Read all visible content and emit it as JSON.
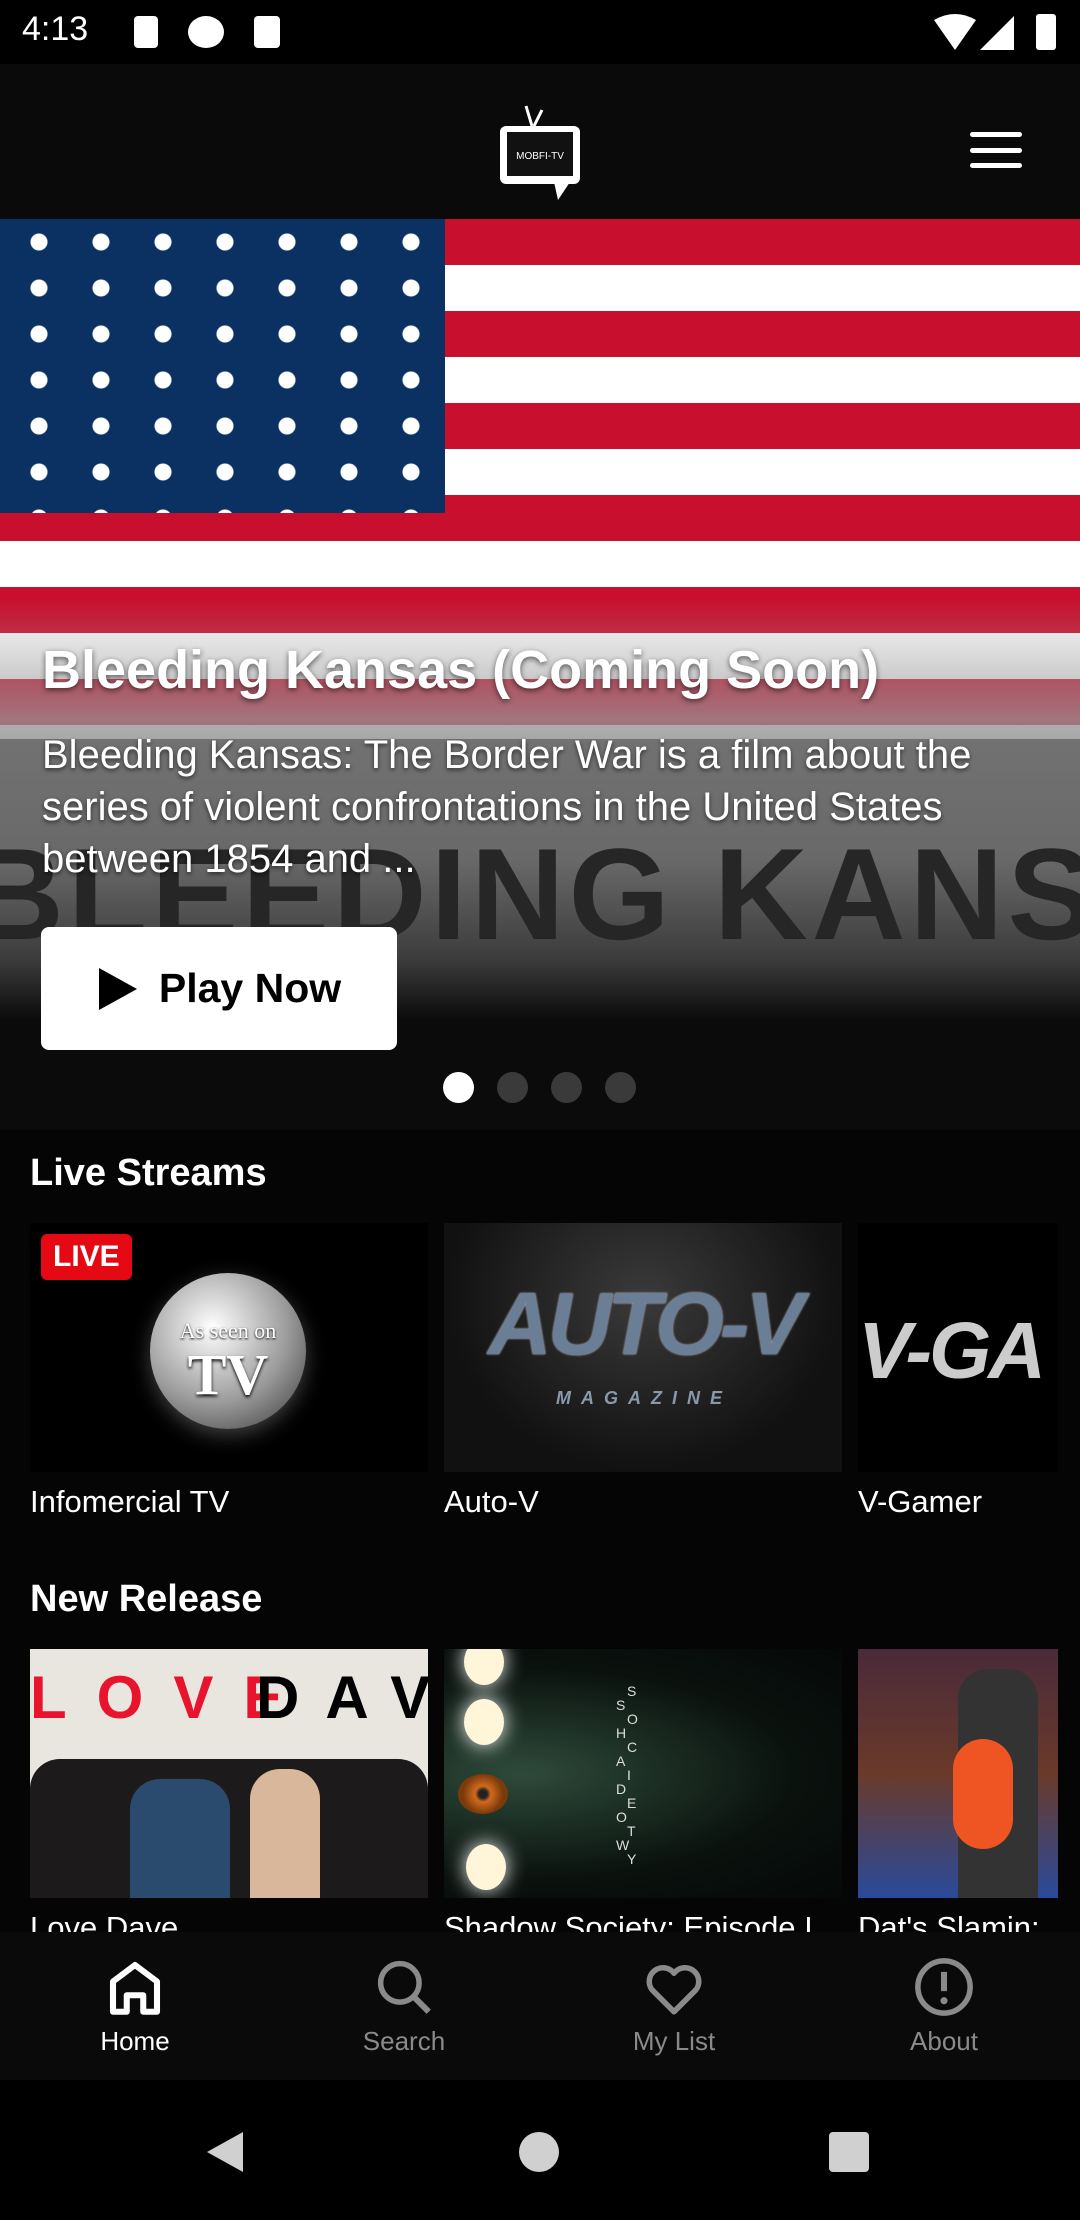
{
  "status_bar": {
    "time": "4:13",
    "icons": [
      "a-notification-icon",
      "p-notification-icon",
      "sd-card-icon",
      "wifi-icon",
      "signal-icon",
      "battery-icon"
    ]
  },
  "header": {
    "logo_text": "MOBFI-TV",
    "menu_icon": "hamburger-menu-icon"
  },
  "hero": {
    "title": "Bleeding Kansas (Coming Soon)",
    "description": "Bleeding Kansas: The Border War is a film about the series of violent confrontations in the United States between 1854 and ...",
    "background_text": "BLEEDING KANSAS",
    "play_label": "Play Now",
    "slides": 4,
    "active_slide": 1
  },
  "sections": [
    {
      "title": "Live Streams",
      "items": [
        {
          "label": "Infomercial TV",
          "badge": "LIVE",
          "thumb_text": "As seen on",
          "thumb_text2": "TV"
        },
        {
          "label": "Auto-V",
          "thumb_text": "AUTO-V",
          "thumb_text2": "MAGAZINE"
        },
        {
          "label": "V-Gamer",
          "thumb_text": "V-GA"
        }
      ]
    },
    {
      "title": "New Release",
      "items": [
        {
          "label": "Love Dave",
          "thumb_text": "LOVE",
          "thumb_text2": "DAVE"
        },
        {
          "label": "Shadow Society: Episode I",
          "thumb_text": "SHADOW",
          "thumb_text2": "SOCIETY"
        },
        {
          "label": "Dat's Slamin:"
        }
      ]
    }
  ],
  "bottom_nav": [
    {
      "label": "Home",
      "icon": "home-icon",
      "active": true
    },
    {
      "label": "Search",
      "icon": "search-icon",
      "active": false
    },
    {
      "label": "My List",
      "icon": "heart-icon",
      "active": false
    },
    {
      "label": "About",
      "icon": "info-icon",
      "active": false
    }
  ],
  "colors": {
    "live_badge": "#e50914",
    "flag_red": "#c8102e",
    "flag_blue": "#0a3161"
  }
}
